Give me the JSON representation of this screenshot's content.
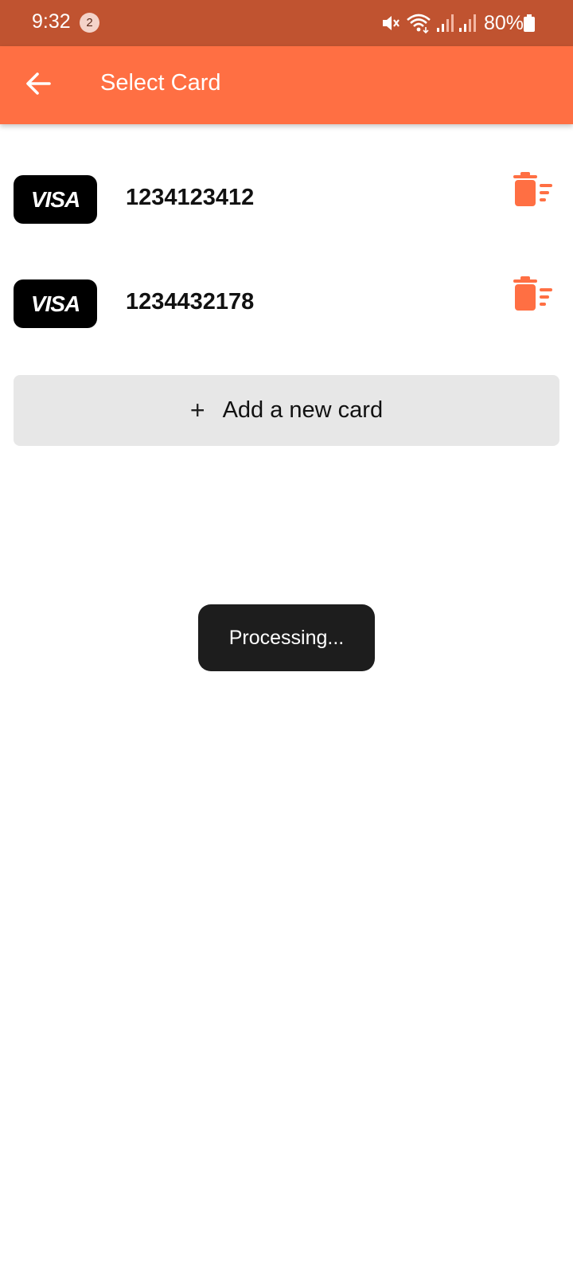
{
  "status_bar": {
    "time": "9:32",
    "notification_count": "2",
    "battery_percent": "80%",
    "icons": [
      "mute-icon",
      "wifi-icon",
      "signal-icon",
      "signal-icon",
      "battery-icon"
    ]
  },
  "app_bar": {
    "title": "Select Card",
    "background_color": "#ff6f43",
    "back_icon": "arrow-left-icon"
  },
  "cards": [
    {
      "brand": "VISA",
      "number": "1234123412",
      "delete_icon": "delete-sweep-icon"
    },
    {
      "brand": "VISA",
      "number": "1234432178",
      "delete_icon": "delete-sweep-icon"
    }
  ],
  "add_card": {
    "icon": "plus",
    "label": "Add a new card"
  },
  "toast": {
    "text": "Processing..."
  },
  "colors": {
    "status_bar": "#c05330",
    "accent": "#ff6f43",
    "add_button_bg": "#e7e7e7",
    "toast_bg": "#1d1d1d"
  }
}
